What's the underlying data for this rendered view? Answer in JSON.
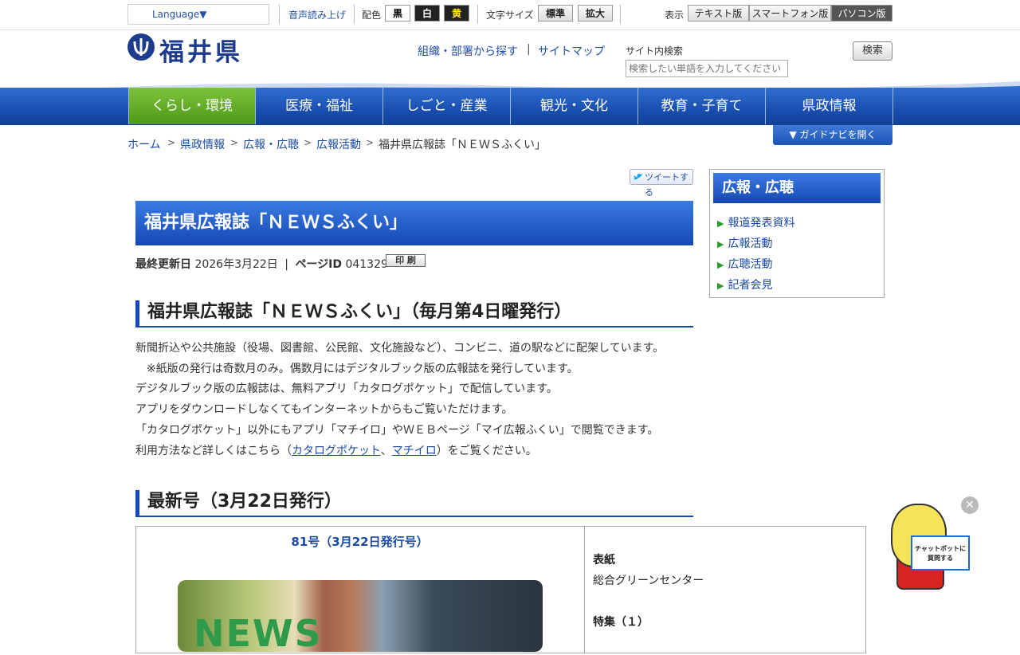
{
  "topbar": {
    "language": "Language▼",
    "voice": "音声読み上げ",
    "color_label": "配色",
    "colors": [
      {
        "label": "黒",
        "bg": "#ffffff",
        "fg": "#000000"
      },
      {
        "label": "白",
        "bg": "#222222",
        "fg": "#ffffff"
      },
      {
        "label": "黄",
        "bg": "#222222",
        "fg": "#ffe600"
      }
    ],
    "fontsize_label": "文字サイズ",
    "fontsize_buttons": [
      "標準",
      "拡大"
    ],
    "view_label": "表示",
    "view_buttons": [
      "テキスト版",
      "スマートフォン版",
      "パソコン版"
    ]
  },
  "header": {
    "logo": "福井県",
    "links": [
      "組織・部署から探す",
      "サイトマップ"
    ],
    "link_sep": "|",
    "search_label": "サイト内検索",
    "search_placeholder": "検索したい単語を入力してください",
    "search_button": "検索"
  },
  "nav": {
    "items": [
      "くらし・環境",
      "医療・福祉",
      "しごと・産業",
      "観光・文化",
      "教育・子育て",
      "県政情報"
    ],
    "guide": "▼ ガイドナビを開く"
  },
  "breadcrumb": {
    "items": [
      "ホーム",
      "県政情報",
      "広報・広聴",
      "広報活動",
      "福井県広報誌「ＮＥＷＳふくい」"
    ],
    "sep": ">"
  },
  "main": {
    "tweet": "ツイートする",
    "title": "福井県広報誌「ＮＥＷＳふくい」",
    "updated_label": "最終更新日",
    "updated_value": "2026年3月22日",
    "meta_sep": "|",
    "pageid_label": "ページID",
    "pageid_value": "041329",
    "print": "印 刷",
    "section1": "福井県広報誌「ＮＥＷＳふくい」（毎月第4日曜発行）",
    "paras": [
      "新聞折込や公共施設（役場、図書館、公民館、文化施設など）、コンビニ、道の駅などに配架しています。",
      "　※紙版の発行は奇数月のみ。偶数月にはデジタルブック版の広報誌を発行しています。",
      "デジタルブック版の広報誌は、無料アプリ「カタログポケット」で配信しています。",
      "アプリをダウンロードしなくてもインターネットからもご覧いただけます。",
      "「カタログポケット」以外にもアプリ「マチイロ」やＷＥＢページ「マイ広報ふくい」で閲覧できます。"
    ],
    "last_para": {
      "prefix": "利用方法など詳しくはこちら（",
      "link1": "カタログポケット",
      "comma": "、",
      "link2": "マチイロ",
      "suffix": "）をご覧ください。"
    },
    "section2": "最新号（3月22日発行）",
    "issue": "81号（3月22日発行号）",
    "cover_text": "NEWS",
    "right": {
      "cover_label": "表紙",
      "cover_value": "総合グリーンセンター",
      "feature_label": "特集（１）"
    }
  },
  "sidebar": {
    "title": "広報・広聴",
    "items": [
      "報道発表資料",
      "広報活動",
      "広聴活動",
      "記者会見"
    ]
  },
  "chatbot": {
    "close": "✕",
    "sign": "チャットボットに\n質問する"
  },
  "colors": {
    "primary": "#1448b4",
    "accent_green": "#4e9a1a",
    "link": "#1a4aa5"
  }
}
